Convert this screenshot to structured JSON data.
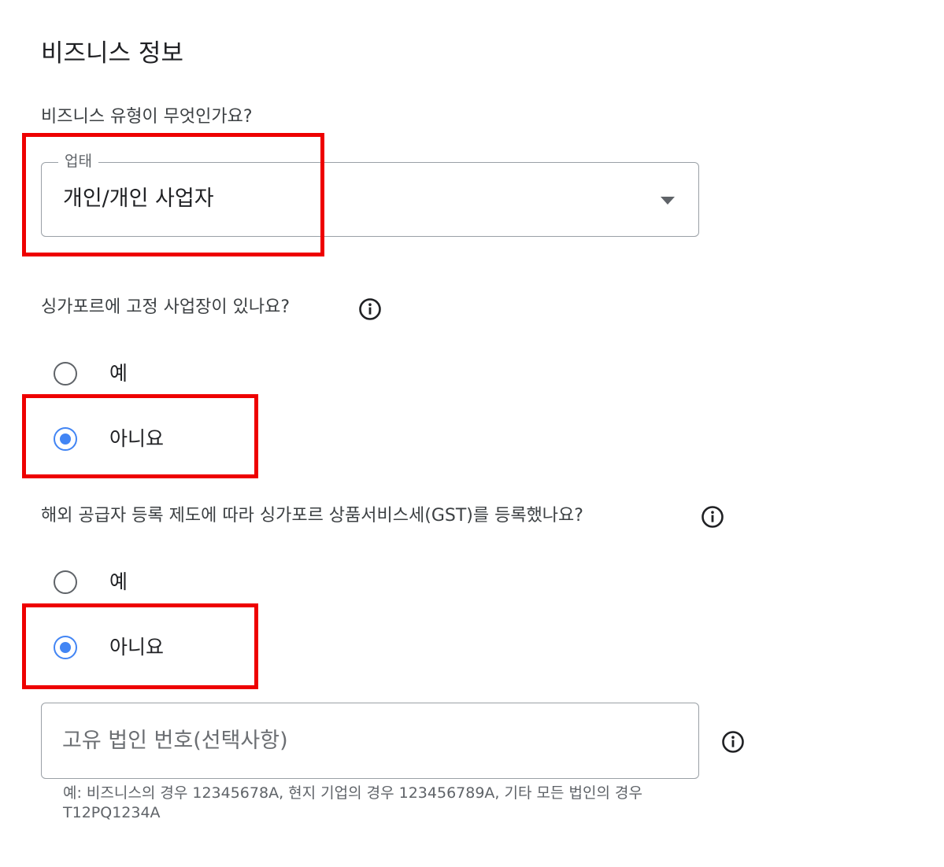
{
  "section": {
    "title": "비즈니스 정보"
  },
  "business_type": {
    "question": "비즈니스 유형이 무엇인가요?",
    "field_label": "업태",
    "selected_value": "개인/개인 사업자"
  },
  "fixed_establishment": {
    "question": "싱가포르에 고정 사업장이 있나요?",
    "options": [
      {
        "label": "예",
        "selected": false
      },
      {
        "label": "아니요",
        "selected": true
      }
    ]
  },
  "gst_registration": {
    "question": "해외 공급자 등록 제도에 따라 싱가포르 상품서비스세(GST)를 등록했나요?",
    "options": [
      {
        "label": "예",
        "selected": false
      },
      {
        "label": "아니요",
        "selected": true
      }
    ]
  },
  "uen": {
    "placeholder": "고유 법인 번호(선택사항)",
    "helper_text": "예: 비즈니스의 경우 12345678A, 현지 기업의 경우 123456789A, 기타 모든 법인의 경우 T12PQ1234A"
  },
  "icons": {
    "info": "info-icon",
    "dropdown": "arrow-drop-down-icon"
  },
  "colors": {
    "accent": "#4285f4",
    "highlight": "#ee0000",
    "border": "#9aa0a6"
  }
}
